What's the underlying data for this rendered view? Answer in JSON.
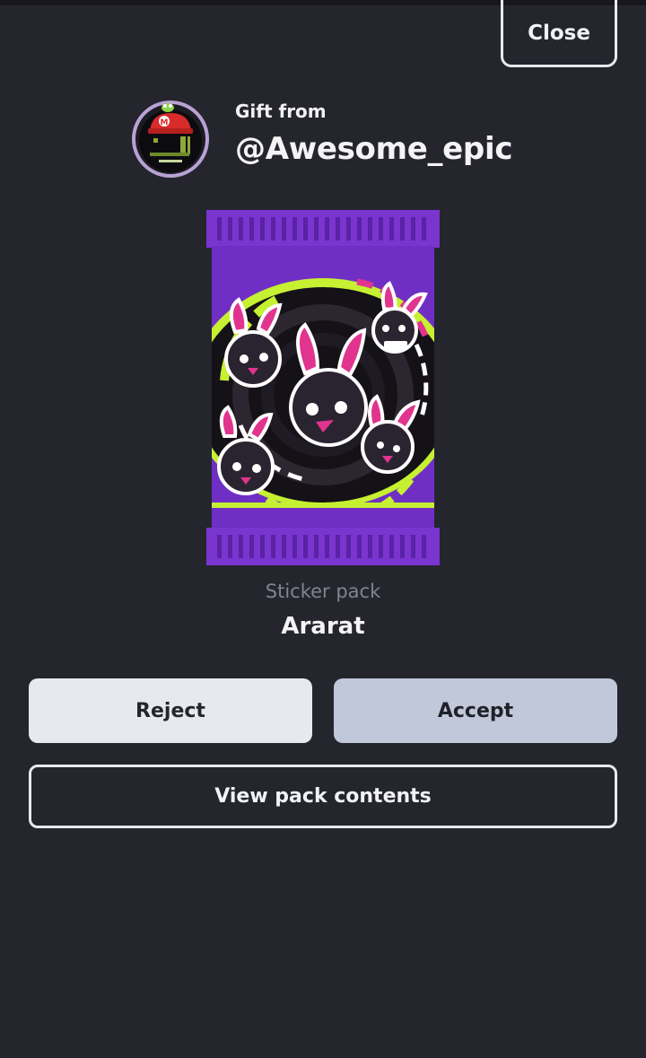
{
  "header": {
    "close_label": "Close"
  },
  "gift": {
    "from_label": "Gift from",
    "sender_handle": "@Awesome_epic",
    "avatar_icon": "sender-avatar-icon"
  },
  "pack": {
    "type_label": "Sticker pack",
    "name": "Ararat",
    "art_icon": "sticker-pack-icon",
    "colors": {
      "wrapper": "#6f2fc4",
      "accent_lime": "#c6f032",
      "accent_pink": "#e0348e",
      "character_body": "#2a2430"
    }
  },
  "actions": {
    "reject_label": "Reject",
    "accept_label": "Accept",
    "view_contents_label": "View pack contents"
  },
  "theme": {
    "background": "#25252e",
    "accept_bg": "#c0c8da",
    "reject_bg": "#e8e8ef"
  }
}
